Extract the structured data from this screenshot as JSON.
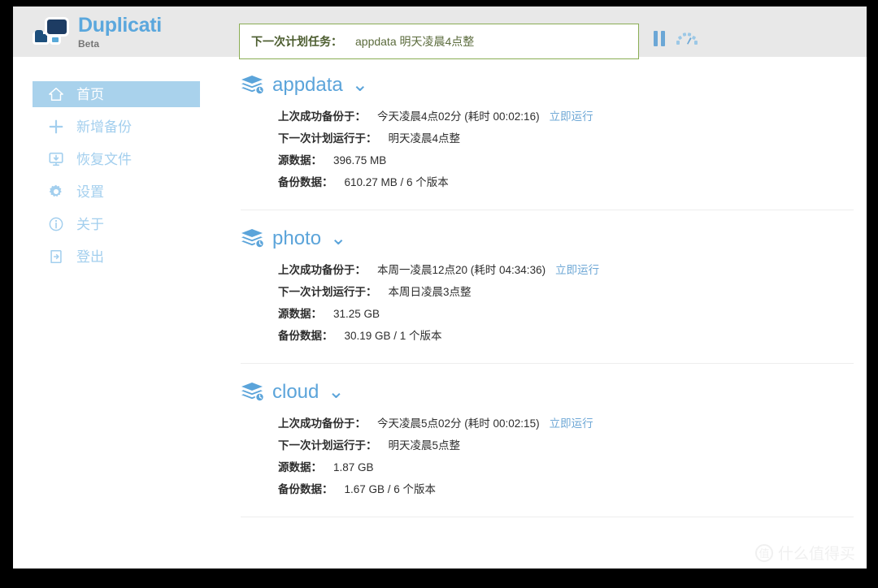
{
  "brand": {
    "title": "Duplicati",
    "subtitle": "Beta",
    "logo_icon": "duplicati-logo-icon",
    "title_color": "#5aa7dd",
    "logo_dark_color": "#1d3c63",
    "logo_accent_color": "#58a9d8"
  },
  "header": {
    "next_task_label": "下一次计划任务：",
    "next_task_value": "appdata 明天凌晨4点整",
    "next_task_border_color": "#8aad54",
    "background_color": "#e8e8e8",
    "pause_icon": "pause-icon",
    "throttle_icon": "throttle-speedometer-icon",
    "icon_color": "#6ba7d6"
  },
  "sidebar": {
    "active_background": "#a9d2ec",
    "text_color": "#a3cfee",
    "items": [
      {
        "label": "首页",
        "icon": "home-icon",
        "active": true
      },
      {
        "label": "新增备份",
        "icon": "plus-icon",
        "active": false
      },
      {
        "label": "恢复文件",
        "icon": "restore-monitor-icon",
        "active": false
      },
      {
        "label": "设置",
        "icon": "gear-icon",
        "active": false
      },
      {
        "label": "关于",
        "icon": "info-circle-icon",
        "active": false
      },
      {
        "label": "登出",
        "icon": "logout-arrow-icon",
        "active": false
      }
    ]
  },
  "main": {
    "link_label": "立即运行",
    "name_color": "#5ba4da",
    "labels": {
      "last_success": "上次成功备份于：",
      "next_run": "下一次计划运行于：",
      "source_data": "源数据：",
      "backup_data": "备份数据："
    },
    "backups": [
      {
        "name": "appdata",
        "icon": "backup-stack-clock-icon",
        "caret": "⌄",
        "last_success": "今天凌晨4点02分 (耗时 00:02:16)",
        "next_run": "明天凌晨4点整",
        "source_data": "396.75 MB",
        "backup_data": "610.27 MB / 6 个版本",
        "run_now": "立即运行"
      },
      {
        "name": "photo",
        "icon": "backup-stack-clock-icon",
        "caret": "⌄",
        "last_success": "本周一凌晨12点20 (耗时 04:34:36)",
        "next_run": "本周日凌晨3点整",
        "source_data": "31.25 GB",
        "backup_data": "30.19 GB / 1 个版本",
        "run_now": "立即运行"
      },
      {
        "name": "cloud",
        "icon": "backup-stack-clock-icon",
        "caret": "⌄",
        "last_success": "今天凌晨5点02分 (耗时 00:02:15)",
        "next_run": "明天凌晨5点整",
        "source_data": "1.87 GB",
        "backup_data": "1.67 GB / 6 个版本",
        "run_now": "立即运行"
      }
    ]
  },
  "watermark": {
    "badge": "值",
    "text": "什么值得买"
  }
}
